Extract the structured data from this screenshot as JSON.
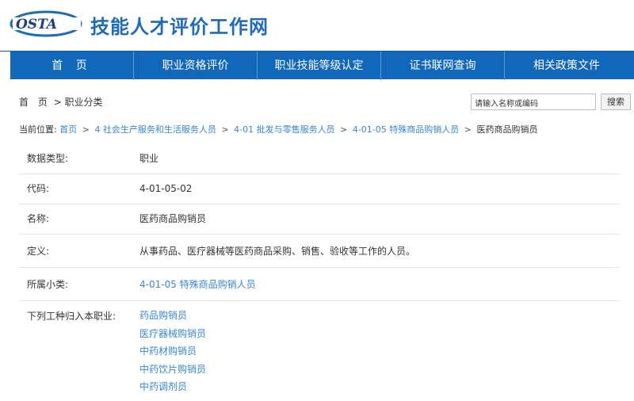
{
  "header": {
    "logo_text": "OSTA",
    "site_title": "技能人才评价工作网"
  },
  "nav": {
    "items": [
      {
        "label": "首 页"
      },
      {
        "label": "职业资格评价"
      },
      {
        "label": "职业技能等级认定"
      },
      {
        "label": "证书联网查询"
      },
      {
        "label": "相关政策文件"
      }
    ]
  },
  "topbar": {
    "home": "首 页",
    "sep": ">",
    "current": "职业分类",
    "search_placeholder": "请输入名称或编码",
    "search_button": "搜索"
  },
  "position": {
    "label": "当前位置:",
    "links": [
      "首页",
      "4 社会生产服务和生活服务人员",
      "4-01 批发与零售服务人员",
      "4-01-05 特殊商品购销人员"
    ],
    "current": "医药商品购销员",
    "sep": ">"
  },
  "details": {
    "data_type_label": "数据类型:",
    "data_type_value": "职业",
    "code_label": "代码:",
    "code_value": "4-01-05-02",
    "name_label": "名称:",
    "name_value": "医药商品购销员",
    "definition_label": "定义:",
    "definition_value": "从事药品、医疗器械等医药商品采购、销售、验收等工作的人员。",
    "category_label": "所属小类:",
    "category_value": "4-01-05 特殊商品购销人员",
    "subtypes_label": "下列工种归入本职业:",
    "subtypes": [
      "药品购销员",
      "医疗器械购销员",
      "中药材购销员",
      "中药饮片购销员",
      "中药调剂员"
    ]
  },
  "colors": {
    "brand": "#1167b9",
    "link": "#3a86cf"
  }
}
